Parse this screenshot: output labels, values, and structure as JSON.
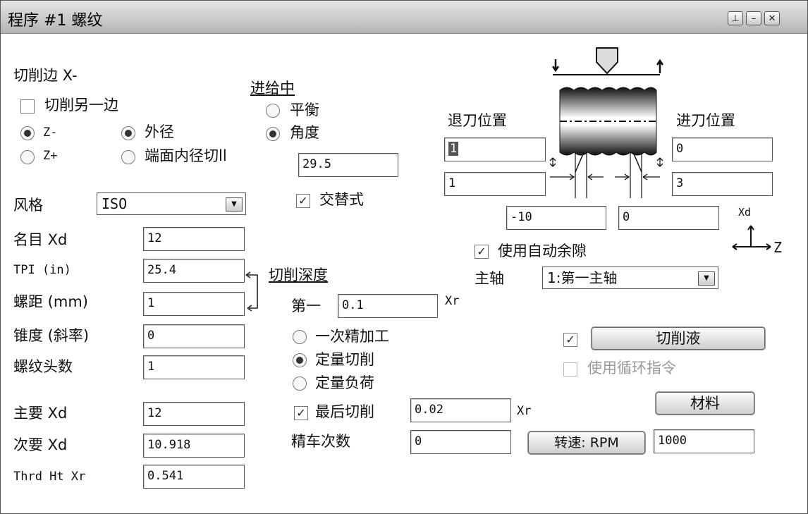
{
  "window": {
    "title": "程序 #1 螺纹",
    "pin_icon": "pin-icon",
    "minimize_icon": "minimize-icon",
    "close_icon": "close-icon"
  },
  "cut_side": {
    "label": "切削边 X-",
    "cut_other_side": "切削另一边",
    "z_minus": "Z-",
    "z_plus": "Z+",
    "outer_dia": "外径",
    "face_inner": "端面内径切ll"
  },
  "feed": {
    "label": "进给中",
    "balance": "平衡",
    "angle": "角度",
    "angle_value": "29.5",
    "alternate": "交替式"
  },
  "style": {
    "label": "风格",
    "value": "ISO"
  },
  "params": {
    "nominal_label": "名目 Xd",
    "nominal_value": "12",
    "tpi_label": "TPI (in)",
    "tpi_value": "25.4",
    "pitch_label": "螺距 (mm)",
    "pitch_value": "1",
    "taper_label": "锥度 (斜率)",
    "taper_value": "0",
    "starts_label": "螺纹头数",
    "starts_value": "1",
    "major_label": "主要 Xd",
    "major_value": "12",
    "minor_label": "次要 Xd",
    "minor_value": "10.918",
    "height_label": "Thrd Ht Xr",
    "height_value": "0.541"
  },
  "depth": {
    "label": "切削深度",
    "first_label": "第一",
    "first_value": "0.1",
    "unit": "Xr",
    "one_pass": "一次精加工",
    "const_cut": "定量切削",
    "const_load": "定量负荷",
    "last_cut": "最后切削",
    "last_cut_value": "0.02",
    "last_cut_unit": "Xr",
    "finish_passes_label": "精车次数",
    "finish_passes_value": "0"
  },
  "positions": {
    "retract_label": "退刀位置",
    "retract_1": "1",
    "retract_2": "1",
    "advance_label": "进刀位置",
    "advance_1": "0",
    "advance_2": "3",
    "bottom_left": "-10",
    "bottom_right": "0",
    "axis_x": "Xd",
    "axis_z": "Z"
  },
  "spindle": {
    "auto_clearance": "使用自动余隙",
    "label": "主轴",
    "value": "1:第一主轴"
  },
  "coolant": {
    "button": "切削液",
    "use_cycle": "使用循环指令"
  },
  "material": {
    "button": "材料"
  },
  "speed": {
    "button": "转速: RPM",
    "value": "1000"
  }
}
